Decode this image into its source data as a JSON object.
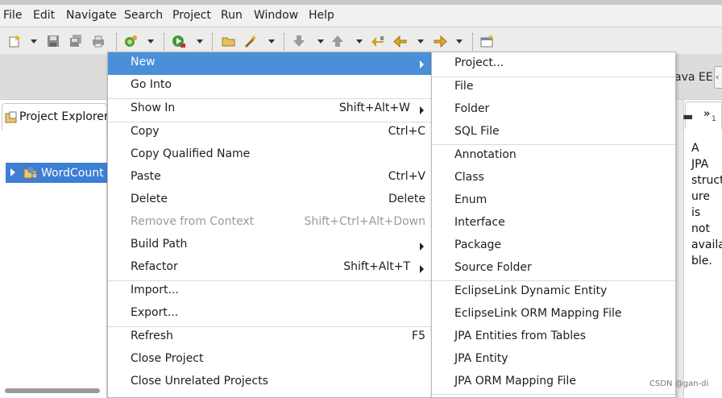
{
  "menubar": [
    "File",
    "Edit",
    "Navigate",
    "Search",
    "Project",
    "Run",
    "Window",
    "Help"
  ],
  "perspective": {
    "label": "ava EE",
    "button": "‹"
  },
  "explorer": {
    "title": "Project Explorer",
    "project": "WordCount"
  },
  "outline": {
    "chevron": "»",
    "count": "1",
    "lines": [
      "A",
      "JPA",
      "struct",
      "ure",
      "is",
      "not",
      "availa",
      "ble."
    ]
  },
  "context_menu": {
    "items": [
      {
        "label": "New",
        "accel": "",
        "submenu": true,
        "highlighted": true
      },
      {
        "label": "Go Into",
        "accel": ""
      },
      {
        "label": "Show In",
        "accel": "Shift+Alt+W",
        "submenu": true
      },
      {
        "label": "Copy",
        "accel": "Ctrl+C"
      },
      {
        "label": "Copy Qualified Name",
        "accel": ""
      },
      {
        "label": "Paste",
        "accel": "Ctrl+V"
      },
      {
        "label": "Delete",
        "accel": "Delete"
      },
      {
        "label": "Remove from Context",
        "accel": "Shift+Ctrl+Alt+Down",
        "disabled": true
      },
      {
        "label": "Build Path",
        "accel": "",
        "submenu": true
      },
      {
        "label": "Refactor",
        "accel": "Shift+Alt+T",
        "submenu": true
      },
      {
        "label": "Import...",
        "accel": ""
      },
      {
        "label": "Export...",
        "accel": ""
      },
      {
        "label": "Refresh",
        "accel": "F5"
      },
      {
        "label": "Close Project",
        "accel": ""
      },
      {
        "label": "Close Unrelated Projects",
        "accel": ""
      }
    ]
  },
  "new_submenu": {
    "items": [
      "Project...",
      "File",
      "Folder",
      "SQL File",
      "Annotation",
      "Class",
      "Enum",
      "Interface",
      "Package",
      "Source Folder",
      "EclipseLink Dynamic Entity",
      "EclipseLink ORM Mapping File",
      "JPA Entities from Tables",
      "JPA Entity",
      "JPA ORM Mapping File"
    ]
  },
  "watermark": "CSDN @gan-di",
  "colors": {
    "highlight": "#4a90d9",
    "selection": "#3c7fd4",
    "disabled": "#9a9a9a"
  }
}
